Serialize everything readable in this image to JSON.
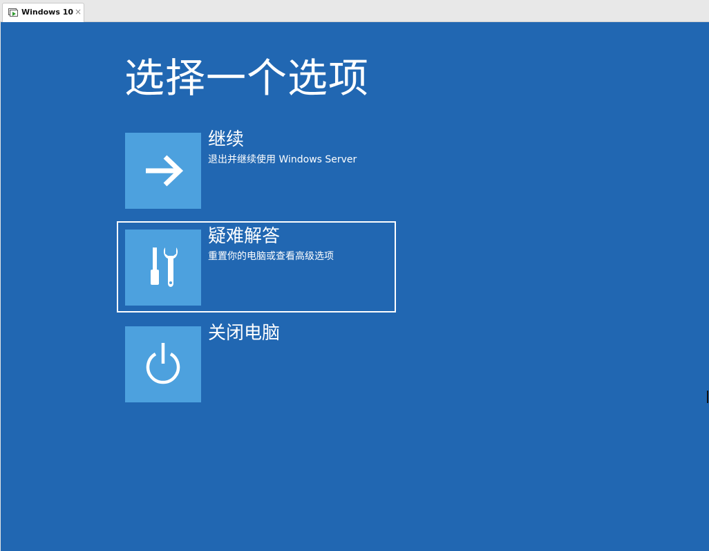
{
  "window": {
    "tab_label": "Windows 10",
    "tab_icon": "vm-icon",
    "close_glyph": "×"
  },
  "colors": {
    "background": "#2167b2",
    "tile": "#4da1de",
    "text": "#ffffff",
    "focus": "#ffffff"
  },
  "page": {
    "title": "选择一个选项"
  },
  "options": [
    {
      "title": "继续",
      "description": "退出并继续使用 Windows Server",
      "icon": "arrow-right-icon",
      "focused": false
    },
    {
      "title": "疑难解答",
      "description": "重置你的电脑或查看高级选项",
      "icon": "tools-icon",
      "focused": true
    },
    {
      "title": "关闭电脑",
      "description": "",
      "icon": "power-icon",
      "focused": false
    }
  ]
}
